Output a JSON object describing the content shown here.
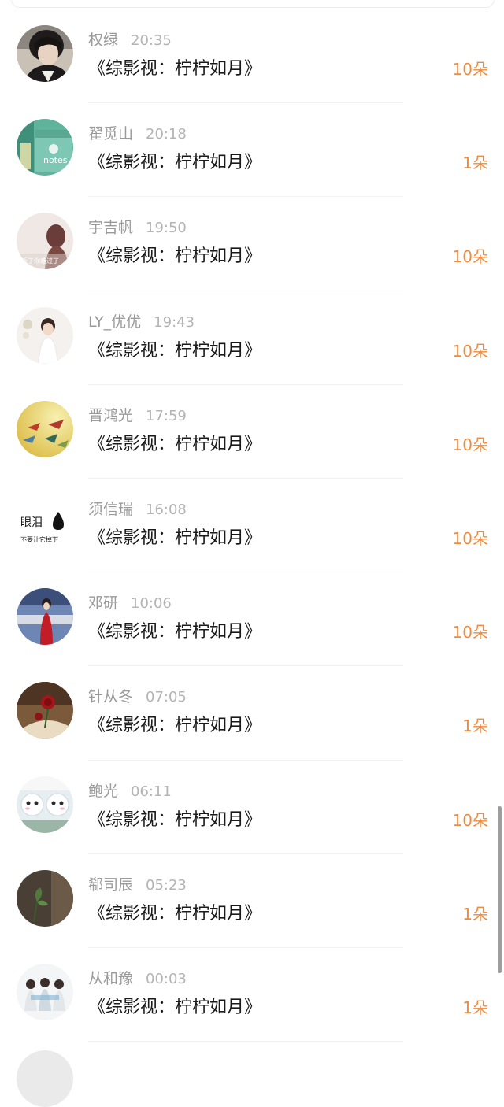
{
  "records": [
    {
      "name": "权绿",
      "time": "20:35",
      "title": "《综影视：柠柠如月》",
      "count": "10朵",
      "avatar_icon": "avatar-dark-hair-photo"
    },
    {
      "name": "翟觅山",
      "time": "20:18",
      "title": "《综影视：柠柠如月》",
      "count": "1朵",
      "avatar_icon": "avatar-notes-photo"
    },
    {
      "name": "宇吉帆",
      "time": "19:50",
      "title": "《综影视：柠柠如月》",
      "count": "10朵",
      "avatar_icon": "avatar-girl-silhouette-photo"
    },
    {
      "name": "LY_优优",
      "time": "19:43",
      "title": "《综影视：柠柠如月》",
      "count": "10朵",
      "avatar_icon": "avatar-little-girl-photo"
    },
    {
      "name": "晋鸿光",
      "time": "17:59",
      "title": "《综影视：柠柠如月》",
      "count": "10朵",
      "avatar_icon": "avatar-paper-cranes-photo"
    },
    {
      "name": "须信瑞",
      "time": "16:08",
      "title": "《综影视：柠柠如月》",
      "count": "10朵",
      "avatar_icon": "avatar-tear-drop-text"
    },
    {
      "name": "邓研",
      "time": "10:06",
      "title": "《综影视：柠柠如月》",
      "count": "10朵",
      "avatar_icon": "avatar-red-dress-photo"
    },
    {
      "name": "针从冬",
      "time": "07:05",
      "title": "《综影视：柠柠如月》",
      "count": "1朵",
      "avatar_icon": "avatar-rose-book-photo"
    },
    {
      "name": "鲍光",
      "time": "06:11",
      "title": "《综影视：柠柠如月》",
      "count": "10朵",
      "avatar_icon": "avatar-cute-dolls-photo"
    },
    {
      "name": "郗司辰",
      "time": "05:23",
      "title": "《综影视：柠柠如月》",
      "count": "1朵",
      "avatar_icon": "avatar-leaf-photo"
    },
    {
      "name": "从和豫",
      "time": "00:03",
      "title": "《综影视：柠柠如月》",
      "count": "1朵",
      "avatar_icon": "avatar-group-photo"
    }
  ],
  "avatar_texts": {
    "tear_main": "眼泪",
    "tear_sub": "不要让它掉下",
    "silhouette_caption": "听了你难过了"
  },
  "colors": {
    "count": "#f08a3c",
    "name": "#9a9a9a",
    "time": "#b4b4b4",
    "title": "#1a1a1a"
  }
}
